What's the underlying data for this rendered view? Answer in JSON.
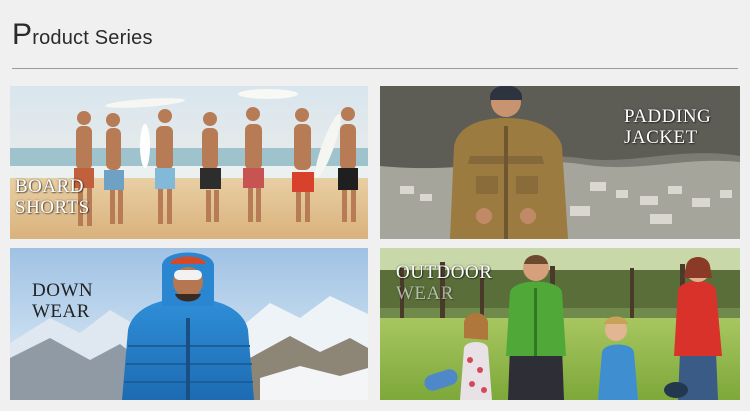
{
  "header": {
    "title_initial": "P",
    "title_rest": "roduct Series"
  },
  "cards": [
    {
      "line1": "BOARD",
      "line2": "SHORTS"
    },
    {
      "line1": "PADDING",
      "line2": "JACKET"
    },
    {
      "line1": "DOWN",
      "line2": "WEAR"
    },
    {
      "line1": "OUTDOOR",
      "line2": "WEAR"
    }
  ]
}
